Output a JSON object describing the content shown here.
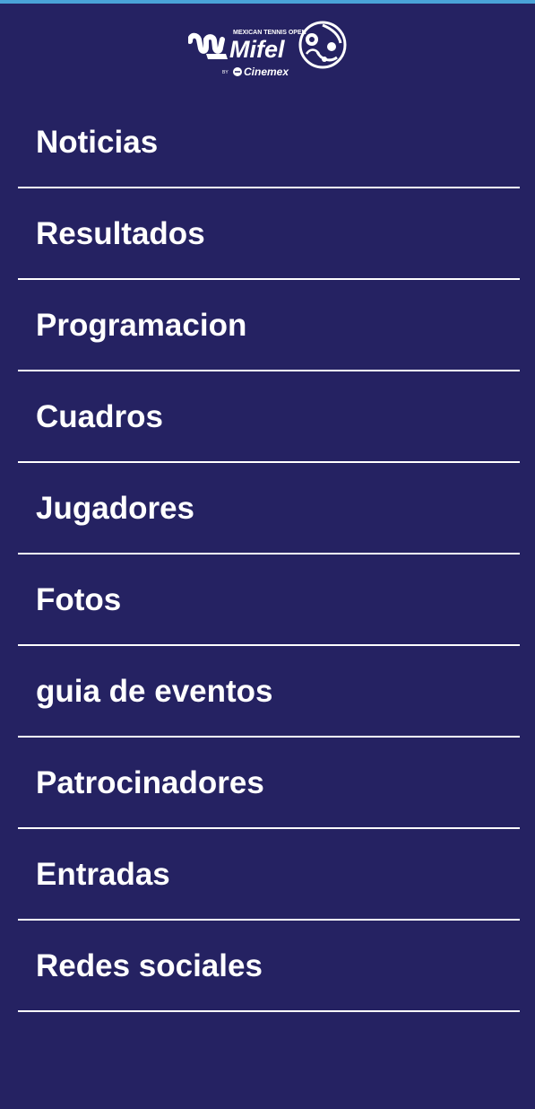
{
  "header": {
    "logo": {
      "top_text": "MEXICAN TENNIS OPEN",
      "brand": "Mifel",
      "by_text": "BY",
      "sponsor": "Cinemex"
    }
  },
  "menu": {
    "items": [
      {
        "label": "Noticias"
      },
      {
        "label": "Resultados"
      },
      {
        "label": "Programacion"
      },
      {
        "label": "Cuadros"
      },
      {
        "label": "Jugadores"
      },
      {
        "label": "Fotos"
      },
      {
        "label": "guia de eventos"
      },
      {
        "label": "Patrocinadores"
      },
      {
        "label": "Entradas"
      },
      {
        "label": "Redes sociales"
      }
    ]
  },
  "colors": {
    "background": "#252262",
    "accent_bar": "#4aa3d8",
    "text": "#ffffff",
    "divider": "#ffffff"
  }
}
